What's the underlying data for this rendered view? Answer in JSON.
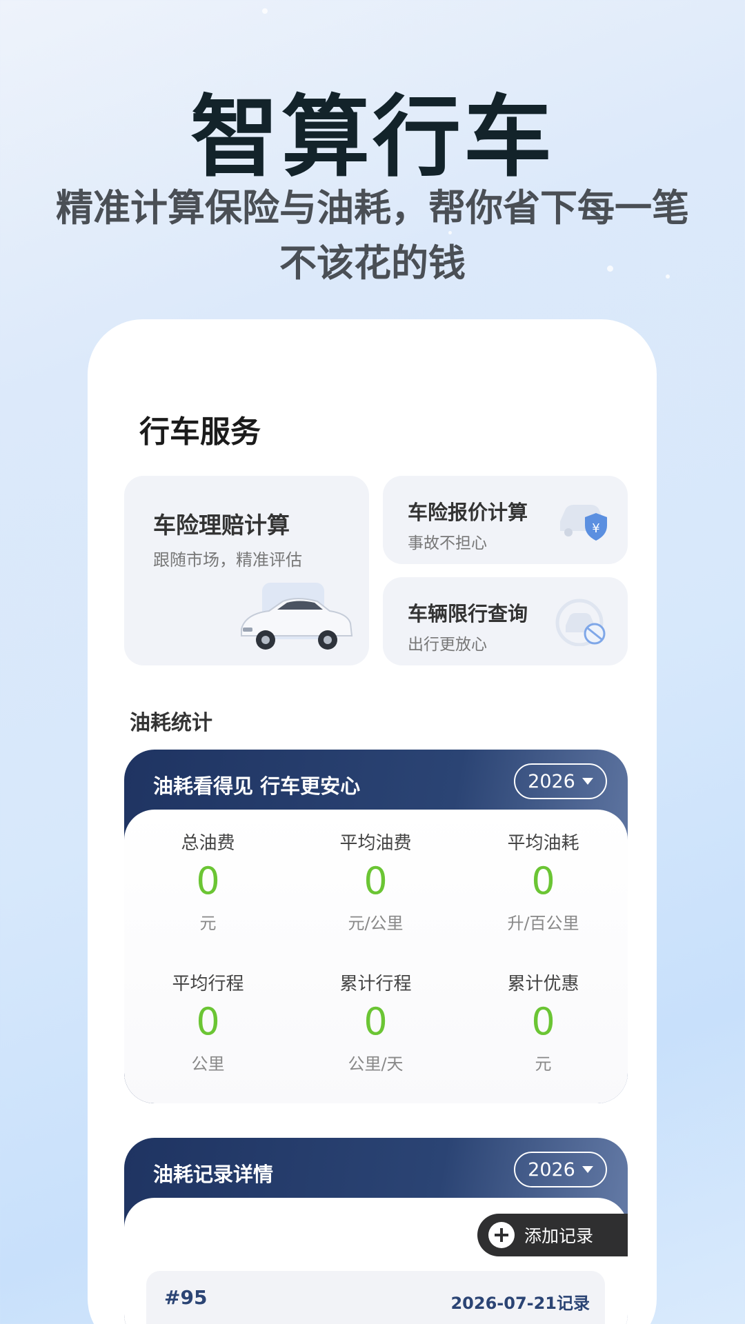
{
  "hero": {
    "title": "智算行车",
    "subtitle_line1": "精准计算保险与油耗，帮你省下每一笔",
    "subtitle_line2": "不该花的钱"
  },
  "services": {
    "section_title": "行车服务",
    "items": [
      {
        "title": "车险理赔计算",
        "subtitle": "跟随市场，精准评估",
        "icon": "car-photo"
      },
      {
        "title": "车险报价计算",
        "subtitle": "事故不担心",
        "icon": "car-shield-yen-icon"
      },
      {
        "title": "车辆限行查询",
        "subtitle": "出行更放心",
        "icon": "car-restricted-icon"
      }
    ]
  },
  "fuel_stats": {
    "section_title": "油耗统计",
    "header": "油耗看得见  行车更安心",
    "year": "2026",
    "items": [
      {
        "label": "总油费",
        "value": "0",
        "unit": "元"
      },
      {
        "label": "平均油费",
        "value": "0",
        "unit": "元/公里"
      },
      {
        "label": "平均油耗",
        "value": "0",
        "unit": "升/百公里"
      },
      {
        "label": "平均行程",
        "value": "0",
        "unit": "公里"
      },
      {
        "label": "累计行程",
        "value": "0",
        "unit": "公里/天"
      },
      {
        "label": "累计优惠",
        "value": "0",
        "unit": "元"
      }
    ]
  },
  "records": {
    "header": "油耗记录详情",
    "year": "2026",
    "add_label": "添加记录",
    "list": [
      {
        "number": "#95",
        "date": "2026-07-21记录"
      }
    ]
  },
  "colors": {
    "accent_green": "#6bc534",
    "panel_navy": "#1f3462",
    "icon_blue": "#5b8fe0"
  }
}
